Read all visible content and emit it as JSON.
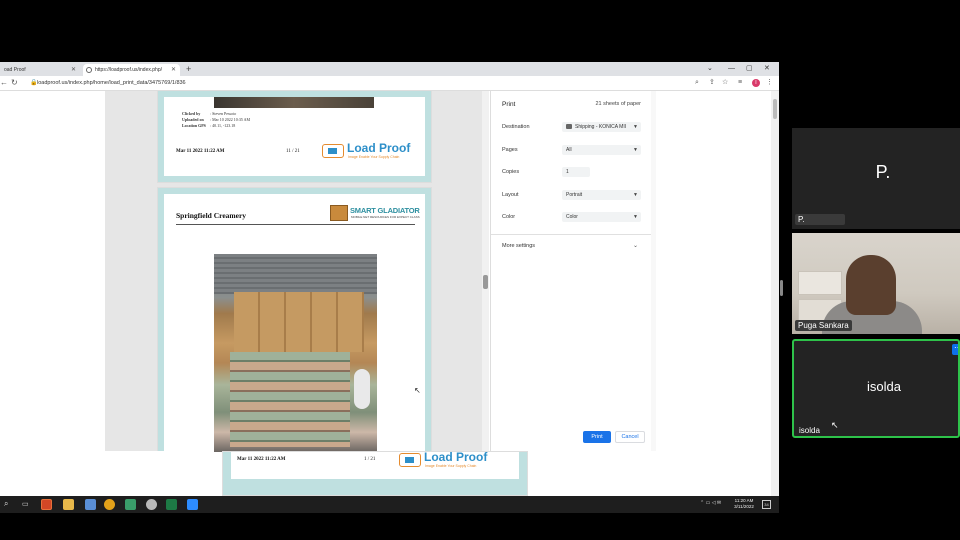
{
  "browser": {
    "tab1_title": "oad Proof",
    "tab2_title": "https://loadproof.us/index.php/",
    "url": "loadproof.us/index.php/home/load_print_data/3475769/1/836",
    "new_tab": "+",
    "profile_initial": "I"
  },
  "page1": {
    "meta": [
      {
        "label": "Clicked by",
        "value": ": Steven Pessoto"
      },
      {
        "label": "Uploaded on",
        "value": ": Mar 10 2022 10:35 AM"
      },
      {
        "label": "Location GPS",
        "value": ": 40.11, -123.18"
      }
    ],
    "date": "Mar 11 2022 11:22 AM",
    "page_num": "11 / 21",
    "logo_text": "Load Proof",
    "logo_sub": "Image Enable Your Supply Chain"
  },
  "page2": {
    "title": "Springfield Creamery",
    "logo_text": "SMART GLADIATOR",
    "logo_sub": "MOBILE NET RESOURCES FOR EXPECT CLASS"
  },
  "page3": {
    "date": "Mar 11 2022 11:22 AM",
    "page_num": "1 / 21",
    "logo_text": "Load Proof",
    "logo_sub": "Image Enable Your Supply Chain"
  },
  "print_dialog": {
    "title": "Print",
    "sheets": "21 sheets of paper",
    "destination_label": "Destination",
    "destination_value": "Shipping - KONICA MII",
    "pages_label": "Pages",
    "pages_value": "All",
    "copies_label": "Copies",
    "copies_value": "1",
    "layout_label": "Layout",
    "layout_value": "Portrait",
    "color_label": "Color",
    "color_value": "Color",
    "more_settings": "More settings",
    "print_button": "Print",
    "cancel_button": "Cancel"
  },
  "taskbar": {
    "time": "11:20 AM",
    "date": "3/11/2022",
    "notif_count": "34"
  },
  "participants": [
    {
      "display": "P.",
      "name": "P."
    },
    {
      "display": "",
      "name": "Puga Sankara"
    },
    {
      "display": "isolda",
      "name": "isolda"
    }
  ],
  "colors": {
    "accent": "#1a73e8",
    "active_speaker": "#2ec24a",
    "page_border": "#bfe0e0"
  }
}
